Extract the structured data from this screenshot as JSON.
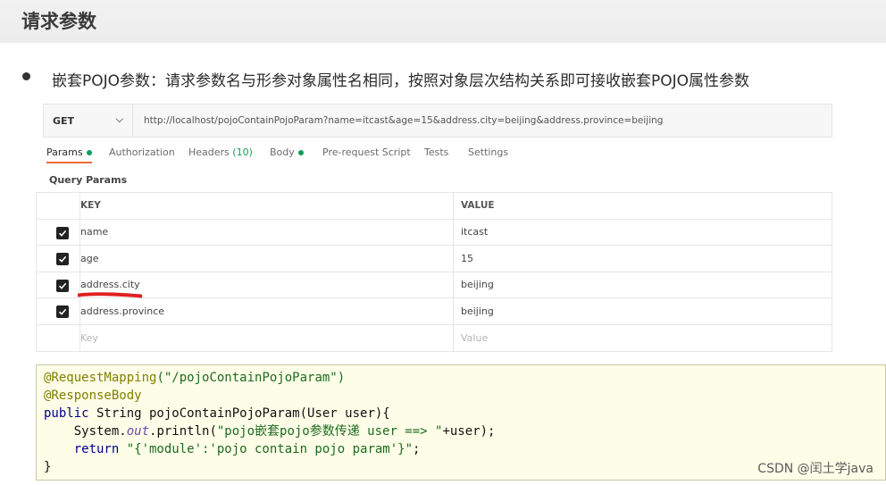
{
  "page": {
    "title": "请求参数"
  },
  "bullet": {
    "text": "嵌套POJO参数：请求参数名与形参对象属性名相同，按照对象层次结构关系即可接收嵌套POJO属性参数"
  },
  "request": {
    "method": "GET",
    "url": "http://localhost/pojoContainPojoParam?name=itcast&age=15&address.city=beijing&address.province=beijing"
  },
  "tabs": [
    {
      "label": "Params",
      "dot": true,
      "active": true
    },
    {
      "label": "Authorization"
    },
    {
      "label": "Headers",
      "count": "(10)"
    },
    {
      "label": "Body",
      "dot": true
    },
    {
      "label": "Pre-request Script"
    },
    {
      "label": "Tests"
    },
    {
      "label": "Settings"
    }
  ],
  "query": {
    "label": "Query Params",
    "key_header": "KEY",
    "value_header": "VALUE",
    "rows": [
      {
        "key": "name",
        "value": "itcast",
        "checked": true
      },
      {
        "key": "age",
        "value": "15",
        "checked": true
      },
      {
        "key": "address.city",
        "value": "beijing",
        "checked": true,
        "underlined": true
      },
      {
        "key": "address.province",
        "value": "beijing",
        "checked": true
      }
    ],
    "placeholder_key": "Key",
    "placeholder_value": "Value"
  },
  "code": {
    "line1_ann": "@RequestMapping",
    "line1_rest": "(\"/pojoContainPojoParam\")",
    "line2": "@ResponseBody",
    "line3_kw": "public",
    "line3_rest": " String pojoContainPojoParam(User user){",
    "line4_a": "    System.",
    "line4_out": "out",
    "line4_b": ".println(",
    "line4_str": "\"pojo嵌套pojo参数传递 user ==> \"",
    "line4_c": "+user);",
    "line5_kw": "    return ",
    "line5_str": "\"{'module':'pojo contain pojo param'}\"",
    "line5_c": ";",
    "line6": "}"
  },
  "watermark": "CSDN @闰土学java",
  "colors": {
    "accent_tab": "#f26b3a",
    "status_green": "#0f9d58",
    "annotation_red": "#e02020"
  }
}
